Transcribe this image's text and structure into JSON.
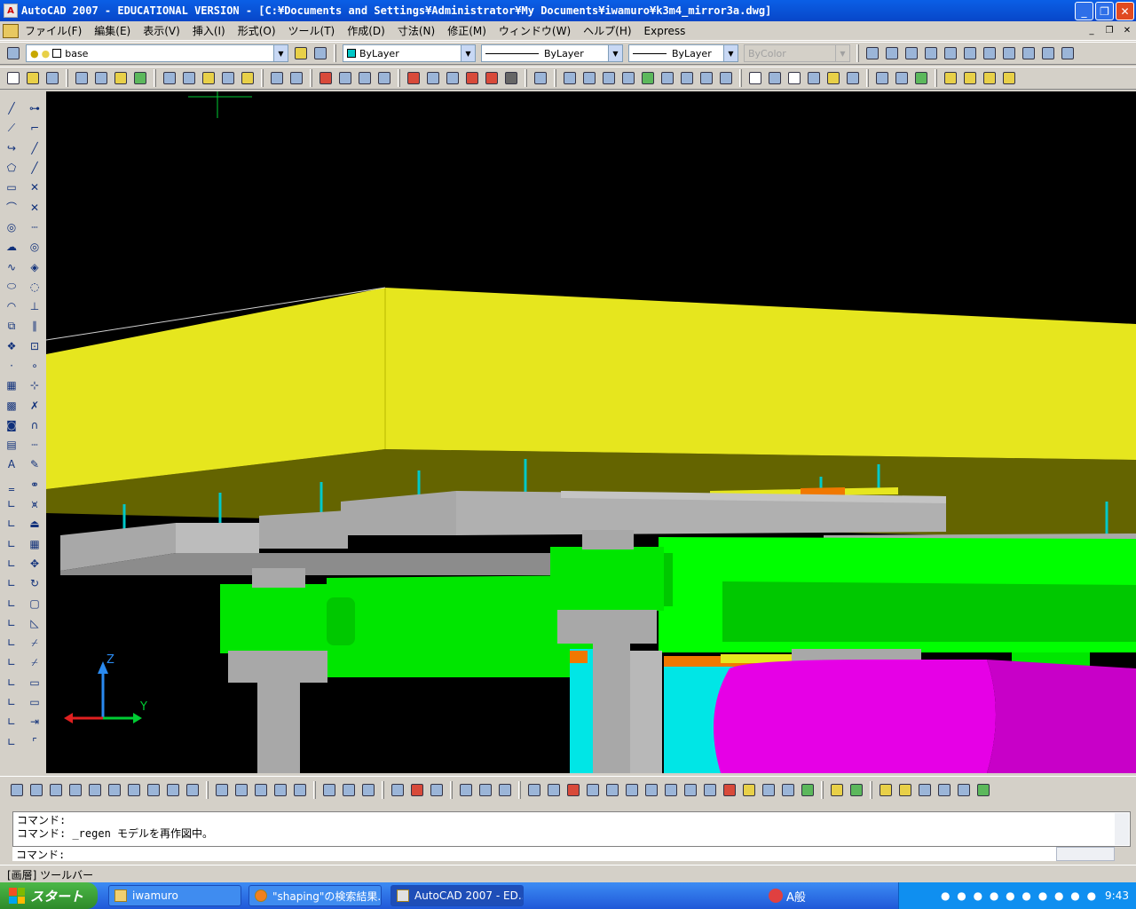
{
  "window": {
    "app_letter": "A",
    "title": "AutoCAD 2007 - EDUCATIONAL VERSION - [C:¥Documents and Settings¥Administrator¥My Documents¥iwamuro¥k3m4_mirror3a.dwg]",
    "minimize": "_",
    "maximize": "❐",
    "close": "✕"
  },
  "menu": {
    "items": [
      "ファイル(F)",
      "編集(E)",
      "表示(V)",
      "挿入(I)",
      "形式(O)",
      "ツール(T)",
      "作成(D)",
      "寸法(N)",
      "修正(M)",
      "ウィンドウ(W)",
      "ヘルプ(H)",
      "Express"
    ],
    "doc_min": "_",
    "doc_restore": "❐",
    "doc_close": "✕"
  },
  "properties": {
    "layer": "base",
    "color": "ByLayer",
    "linetype": "ByLayer",
    "lineweight": "ByLayer",
    "plotstyle": "ByColor"
  },
  "viewport": {
    "axis_z": "Z",
    "axis_y": "Y",
    "colors": {
      "yellow": "#e6e61e",
      "olive": "#646400",
      "green": "#00ff00",
      "gray": "#a8a8a8",
      "magenta": "#e600e6",
      "cyan": "#00e6e6",
      "orange": "#f07800"
    }
  },
  "command": {
    "line1": "コマンド:",
    "line2": "コマンド: _regen モデルを再作図中。",
    "prompt": "コマンド:"
  },
  "status": {
    "text": "[画層] ツールバー"
  },
  "taskbar": {
    "start": "スタート",
    "tasks": [
      "iwamuro",
      "\"shaping\"の検索結果...",
      "AutoCAD 2007 - ED..."
    ],
    "ime": "A般",
    "clock": "9:43"
  }
}
